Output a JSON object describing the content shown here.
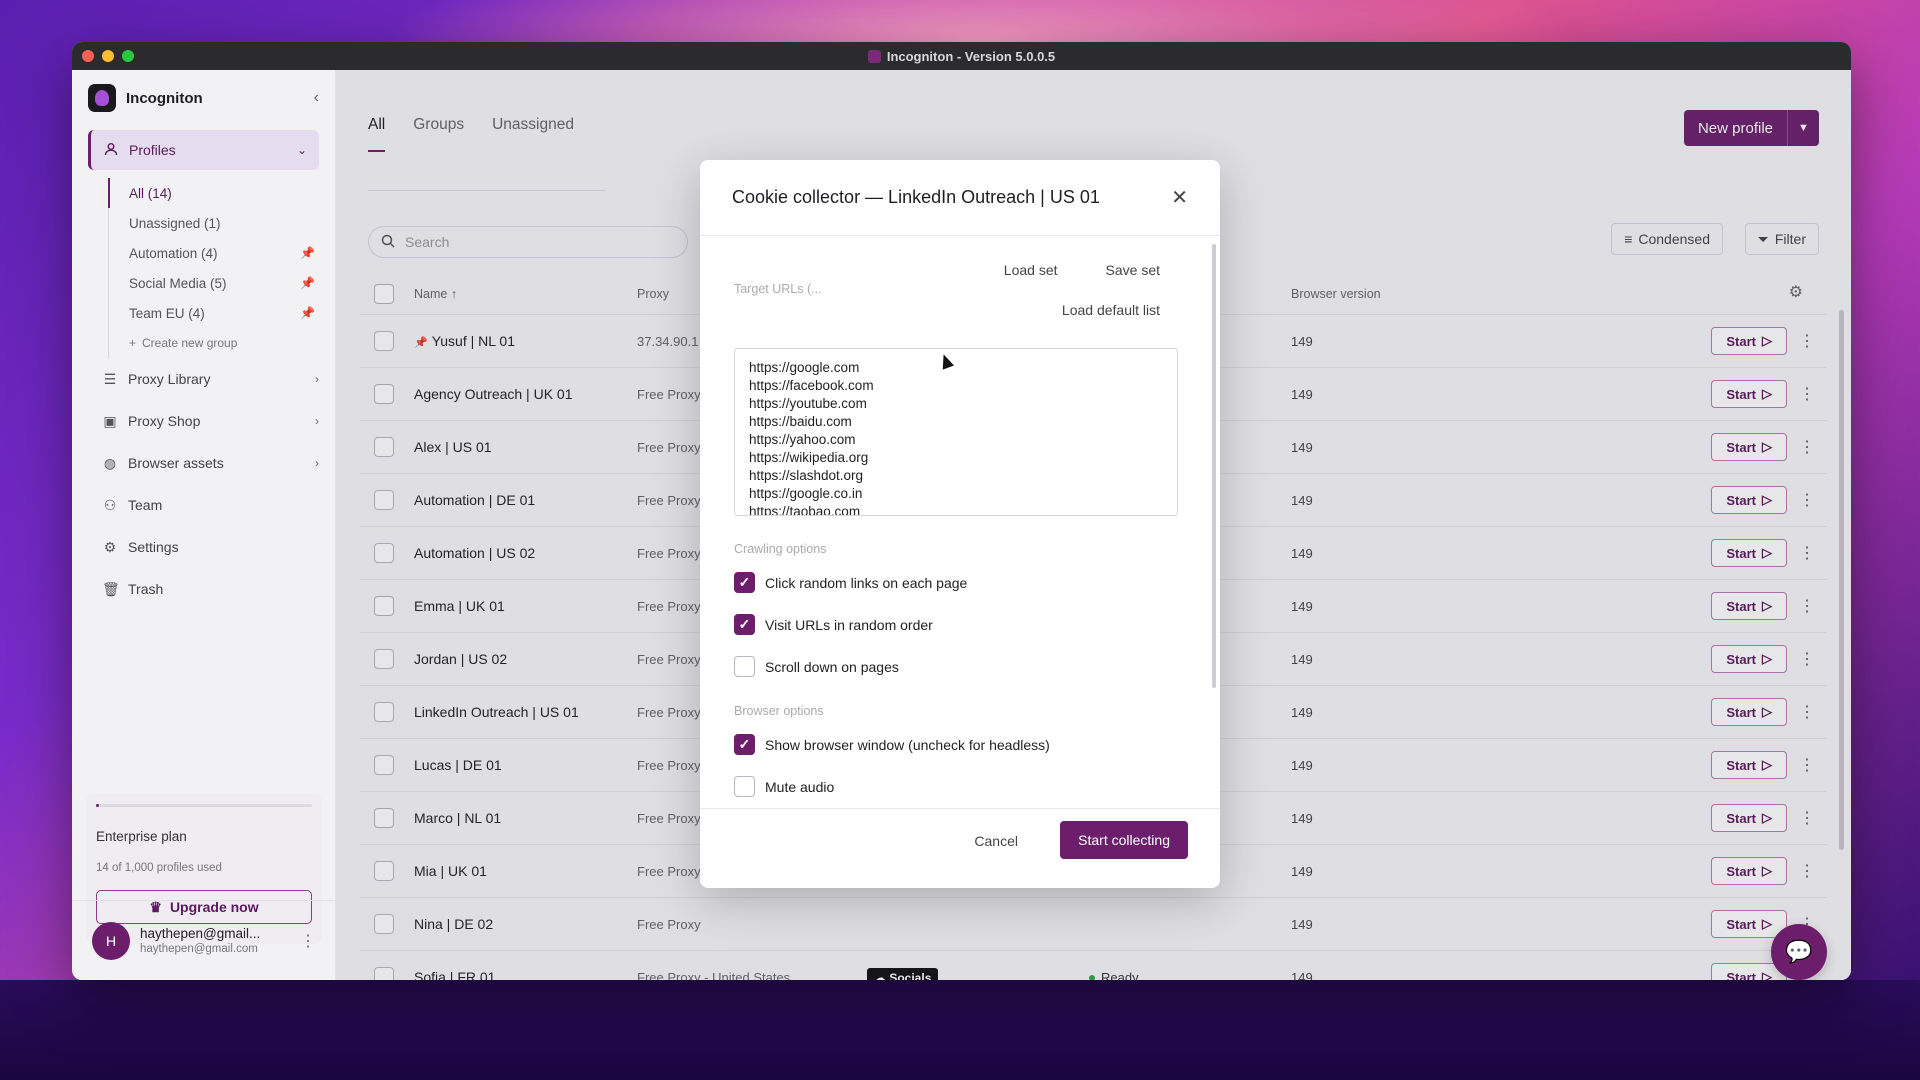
{
  "window": {
    "title": "Incogniton - Version 5.0.0.5"
  },
  "sidebar": {
    "brand": "Incogniton",
    "profiles_label": "Profiles",
    "groups": [
      {
        "label": "All (14)",
        "active": true,
        "pinned": false
      },
      {
        "label": "Unassigned (1)",
        "active": false,
        "pinned": false
      },
      {
        "label": "Automation (4)",
        "active": false,
        "pinned": true
      },
      {
        "label": "Social Media (5)",
        "active": false,
        "pinned": true
      },
      {
        "label": "Team EU (4)",
        "active": false,
        "pinned": true
      }
    ],
    "create_group": "Create new group",
    "nav": [
      {
        "label": "Proxy Library",
        "icon": "list-icon",
        "chevron": true
      },
      {
        "label": "Proxy Shop",
        "icon": "shop-icon",
        "chevron": true
      },
      {
        "label": "Browser assets",
        "icon": "globe-icon",
        "chevron": true
      },
      {
        "label": "Team",
        "icon": "team-icon",
        "chevron": false
      },
      {
        "label": "Settings",
        "icon": "gear-icon",
        "chevron": false
      },
      {
        "label": "Trash",
        "icon": "trash-icon",
        "chevron": false
      }
    ],
    "plan": {
      "name": "Enterprise plan",
      "usage": "14 of 1,000 profiles used",
      "usage_fraction": 0.014,
      "upgrade_label": "Upgrade now"
    },
    "user": {
      "initial": "H",
      "name": "haythepen@gmail...",
      "email": "haythepen@gmail.com"
    }
  },
  "main": {
    "tabs": [
      {
        "label": "All",
        "active": true
      },
      {
        "label": "Groups",
        "active": false
      },
      {
        "label": "Unassigned",
        "active": false
      }
    ],
    "new_profile_label": "New profile",
    "search_placeholder": "Search",
    "condensed_label": "Condensed",
    "filter_label": "Filter",
    "columns": {
      "name": "Name ↑",
      "proxy": "Proxy",
      "browser_version": "Browser version"
    },
    "start_label": "Start",
    "rows": [
      {
        "name": "Yusuf | NL 01",
        "pinned": true,
        "proxy": "37.34.90.1",
        "tag": "",
        "status": "",
        "version": "149"
      },
      {
        "name": "Agency Outreach | UK 01",
        "pinned": false,
        "proxy": "Free Proxy",
        "tag": "",
        "status": "",
        "version": "149"
      },
      {
        "name": "Alex | US 01",
        "pinned": false,
        "proxy": "Free Proxy",
        "tag": "",
        "status": "",
        "version": "149"
      },
      {
        "name": "Automation | DE 01",
        "pinned": false,
        "proxy": "Free Proxy",
        "tag": "",
        "status": "",
        "version": "149"
      },
      {
        "name": "Automation | US 02",
        "pinned": false,
        "proxy": "Free Proxy",
        "tag": "",
        "status": "",
        "version": "149"
      },
      {
        "name": "Emma | UK 01",
        "pinned": false,
        "proxy": "Free Proxy",
        "tag": "",
        "status": "",
        "version": "149"
      },
      {
        "name": "Jordan | US 02",
        "pinned": false,
        "proxy": "Free Proxy",
        "tag": "",
        "status": "",
        "version": "149"
      },
      {
        "name": "LinkedIn Outreach | US 01",
        "pinned": false,
        "proxy": "Free Proxy",
        "tag": "",
        "status": "",
        "version": "149"
      },
      {
        "name": "Lucas | DE 01",
        "pinned": false,
        "proxy": "Free Proxy",
        "tag": "",
        "status": "",
        "version": "149"
      },
      {
        "name": "Marco | NL 01",
        "pinned": false,
        "proxy": "Free Proxy",
        "tag": "",
        "status": "",
        "version": "149"
      },
      {
        "name": "Mia | UK 01",
        "pinned": false,
        "proxy": "Free Proxy",
        "tag": "",
        "status": "",
        "version": "149"
      },
      {
        "name": "Nina | DE 02",
        "pinned": false,
        "proxy": "Free Proxy",
        "tag": "",
        "status": "",
        "version": "149"
      },
      {
        "name": "Sofia | FR 01",
        "pinned": false,
        "proxy": "Free Proxy - United States",
        "tag": "Socials",
        "status": "Ready",
        "version": "149"
      }
    ]
  },
  "modal": {
    "title": "Cookie collector — LinkedIn Outreach | US 01",
    "load_set": "Load set",
    "save_set": "Save set",
    "target_label": "Target URLs (...",
    "load_default": "Load default list",
    "urls": [
      "https://google.com",
      "https://facebook.com",
      "https://youtube.com",
      "https://baidu.com",
      "https://yahoo.com",
      "https://wikipedia.org",
      "https://slashdot.org",
      "https://google.co.in",
      "https://taobao.com"
    ],
    "crawling_label": "Crawling options",
    "crawling": [
      {
        "label": "Click random links on each page",
        "checked": true
      },
      {
        "label": "Visit URLs in random order",
        "checked": true
      },
      {
        "label": "Scroll down on pages",
        "checked": false
      }
    ],
    "browser_label": "Browser options",
    "browser": [
      {
        "label": "Show browser window (uncheck for headless)",
        "checked": true
      },
      {
        "label": "Mute audio",
        "checked": false
      }
    ],
    "cancel_label": "Cancel",
    "start_label": "Start collecting"
  },
  "colors": {
    "accent": "#6c1e6d",
    "status_ready": "#2aa745"
  }
}
